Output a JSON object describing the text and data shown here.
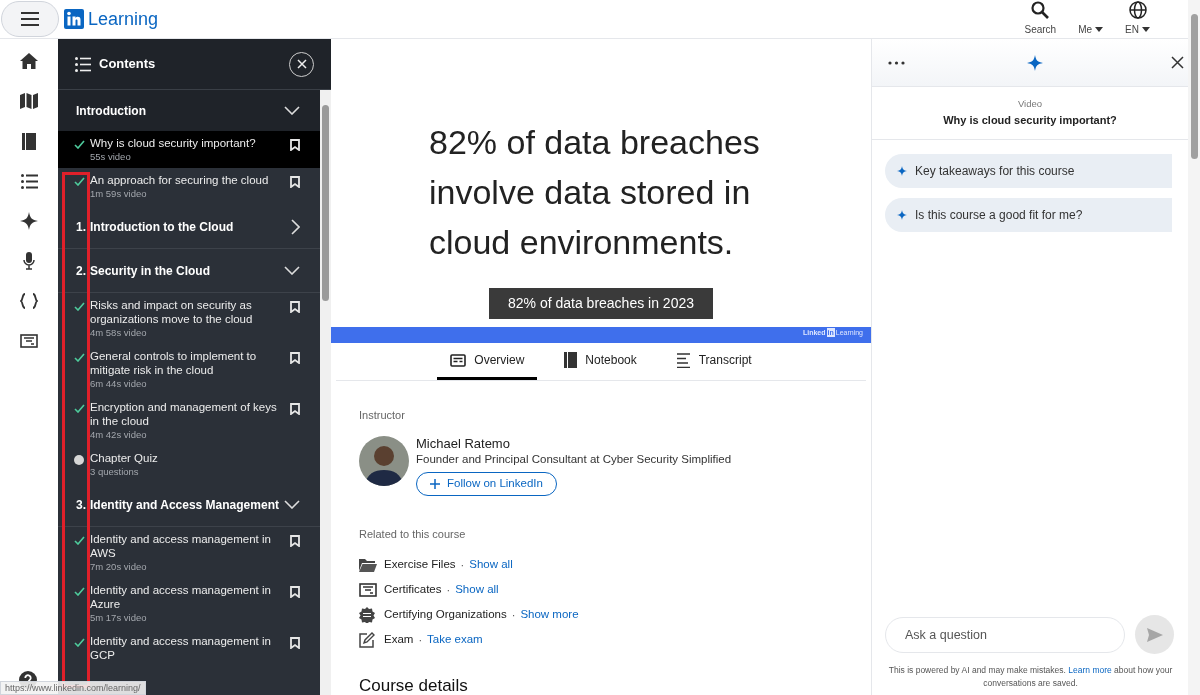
{
  "header": {
    "logo_text": "Learning",
    "nav": [
      {
        "kind": "search",
        "label": "Search"
      },
      {
        "kind": "me",
        "label": "Me"
      },
      {
        "kind": "language",
        "label": "EN"
      }
    ]
  },
  "contents": {
    "title": "Contents",
    "sections": [
      {
        "title": "Introduction",
        "expanded": true,
        "items": [
          {
            "kind": "video",
            "title": "Why is cloud security important?",
            "meta": "55s video",
            "completed": true,
            "selected": true
          },
          {
            "kind": "video",
            "title": "An approach for securing the cloud",
            "meta": "1m 59s video",
            "completed": true,
            "selected": false
          }
        ]
      },
      {
        "number": "1.",
        "title": "Introduction to the Cloud",
        "expanded": false
      },
      {
        "number": "2.",
        "title": "Security in the Cloud",
        "expanded": true,
        "items": [
          {
            "kind": "video",
            "title": "Risks and impact on security as organizations move to the cloud",
            "meta": "4m 58s video",
            "completed": true,
            "selected": false
          },
          {
            "kind": "video",
            "title": "General controls to implement to mitigate risk in the cloud",
            "meta": "6m 44s video",
            "completed": true,
            "selected": false
          },
          {
            "kind": "video",
            "title": "Encryption and management of keys in the cloud",
            "meta": "4m 42s video",
            "completed": true,
            "selected": false
          },
          {
            "kind": "quiz",
            "title": "Chapter Quiz",
            "meta": "3 questions",
            "completed": false,
            "selected": false
          }
        ]
      },
      {
        "number": "3.",
        "title": "Identity and Access Management",
        "expanded": true,
        "items": [
          {
            "kind": "video",
            "title": "Identity and access management in AWS",
            "meta": "7m 20s video",
            "completed": true,
            "selected": false
          },
          {
            "kind": "video",
            "title": "Identity and access management in Azure",
            "meta": "5m 17s video",
            "completed": true,
            "selected": false
          },
          {
            "kind": "video",
            "title": "Identity and access management in GCP",
            "completed": true,
            "selected": false
          }
        ]
      }
    ]
  },
  "video": {
    "slide_lines": [
      "82% of data breaches",
      "involve data stored in",
      "cloud environments."
    ],
    "caption": "82% of data breaches in 2023",
    "brand_linked": "Linked",
    "brand_in": "in",
    "brand_learning": "Learning"
  },
  "tabs": [
    {
      "kind": "overview",
      "label": "Overview",
      "selected": true
    },
    {
      "kind": "notebook",
      "label": "Notebook",
      "selected": false
    },
    {
      "kind": "transcript",
      "label": "Transcript",
      "selected": false
    }
  ],
  "instructor": {
    "heading": "Instructor",
    "name": "Michael Ratemo",
    "role": "Founder and Principal Consultant at Cyber Security Simplified",
    "follow": "Follow on LinkedIn"
  },
  "related": {
    "heading": "Related to this course",
    "items": [
      {
        "kind": "files",
        "label": "Exercise Files",
        "separator": "·",
        "link": "Show all"
      },
      {
        "kind": "certificate",
        "label": "Certificates",
        "separator": "·",
        "link": "Show all"
      },
      {
        "kind": "badge",
        "label": "Certifying Organizations",
        "separator": "·",
        "link": "Show more"
      },
      {
        "kind": "exam",
        "label": "Exam",
        "separator": "·",
        "link": "Take exam"
      }
    ]
  },
  "course_details": {
    "heading": "Course details"
  },
  "assistant": {
    "context_label": "Video",
    "context_title": "Why is cloud security important?",
    "suggestions": [
      "Key takeaways for this course",
      "Is this course a good fit for me?"
    ],
    "input": {
      "placeholder": "Ask a question"
    },
    "disclaimer_before": "This is powered by AI and may make mistakes.",
    "disclaimer_link": "Learn more",
    "disclaimer_after": "about how your conversations are saved."
  },
  "status_url": "https://www.linkedin.com/learning/"
}
